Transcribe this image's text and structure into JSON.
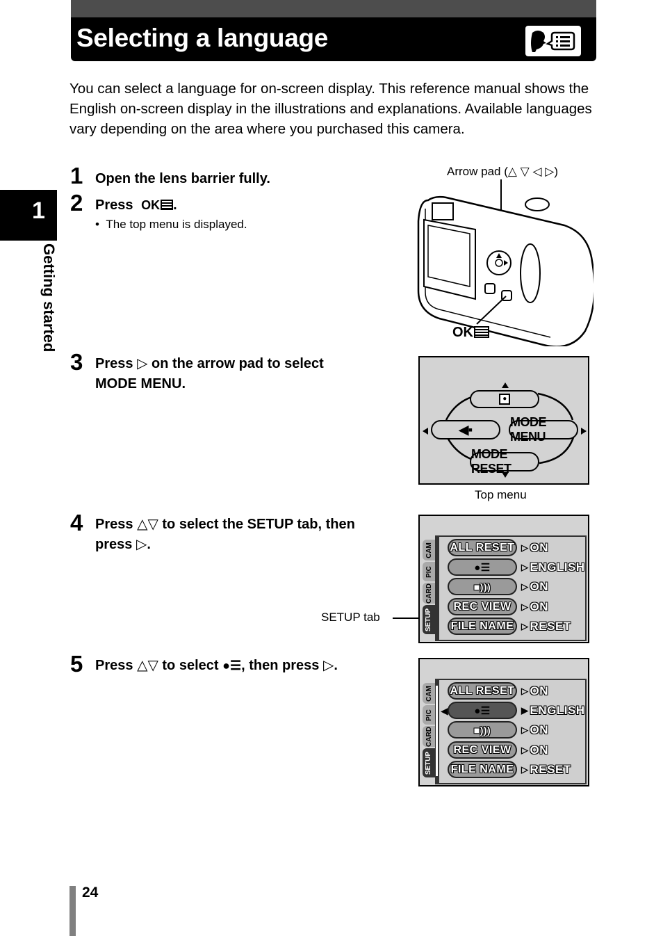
{
  "header": {
    "title": "Selecting a language",
    "icon": "language-icon"
  },
  "side_tab": {
    "chapter_number": "1",
    "chapter_title": "Getting started"
  },
  "intro": "You can select a language for on-screen display. This reference manual shows the English on-screen display in the illustrations and explanations. Available languages vary depending on the area where you purchased this camera.",
  "steps": [
    {
      "number": "1",
      "text": "Open the lens barrier fully."
    },
    {
      "number": "2",
      "text_before": "Press",
      "button": "OK",
      "text_after": ".",
      "bullet": "The top menu is displayed."
    },
    {
      "number": "3",
      "text_before": "Press",
      "symbol": "▷",
      "text_after": "on the arrow pad to select",
      "line2": "MODE MENU."
    },
    {
      "number": "4",
      "text_before": "Press",
      "symbol": "△▽",
      "text_after": "to select the SETUP tab, then",
      "line2_before": "press",
      "line2_symbol": "▷",
      "line2_after": "."
    },
    {
      "number": "5",
      "text_before": "Press",
      "symbol": "△▽",
      "text_mid": "to select",
      "text_after": ", then press",
      "end_symbol": "▷",
      "end": "."
    }
  ],
  "camera_figure": {
    "arrow_pad_label": "Arrow pad (",
    "arrow_pad_symbols": "△ ▽ ◁ ▷",
    "arrow_pad_close": ")",
    "ok_label": "OK"
  },
  "top_menu": {
    "caption": "Top menu",
    "items": {
      "top": "movie-icon",
      "left": "quality-icon",
      "right": "MODE MENU",
      "bottom": "MODE RESET"
    }
  },
  "setup_menu": {
    "callout": "SETUP tab",
    "tabs": [
      "CAM",
      "PIC",
      "CARD",
      "SETUP"
    ],
    "active_tab": "SETUP",
    "rows": [
      {
        "label": "ALL RESET",
        "value": "ON"
      },
      {
        "label": "",
        "icon": "language-icon",
        "value": "ENGLISH"
      },
      {
        "label": "",
        "icon": "beep-icon",
        "value": "ON"
      },
      {
        "label": "REC VIEW",
        "value": "ON"
      },
      {
        "label": "FILE NAME",
        "value": "RESET"
      }
    ]
  },
  "setup_menu_selected": {
    "selected_row": 1
  },
  "footer": {
    "page_number": "24"
  }
}
